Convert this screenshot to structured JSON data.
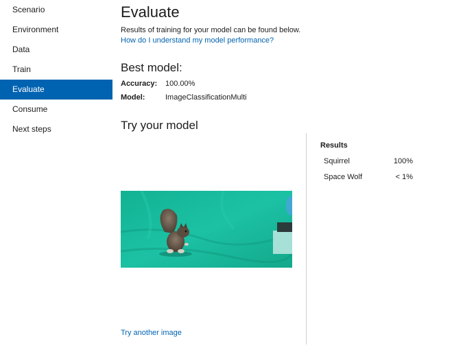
{
  "sidebar": {
    "items": [
      {
        "label": "Scenario"
      },
      {
        "label": "Environment"
      },
      {
        "label": "Data"
      },
      {
        "label": "Train"
      },
      {
        "label": "Evaluate",
        "active": true
      },
      {
        "label": "Consume"
      },
      {
        "label": "Next steps"
      }
    ],
    "active_color": "#0063b1"
  },
  "main": {
    "title": "Evaluate",
    "description": "Results of training for your model can be found below.",
    "help_link": "How do I understand my model performance?",
    "best_model": {
      "heading": "Best model:",
      "accuracy_label": "Accuracy:",
      "accuracy_value": "100.00%",
      "model_label": "Model:",
      "model_value": "ImageClassificationMulti"
    },
    "try_model": {
      "heading": "Try your model",
      "image_icon": "squirrel-toy-photo",
      "try_another_link": "Try another image"
    }
  },
  "results": {
    "title": "Results",
    "rows": [
      {
        "label": "Squirrel",
        "value": "100%"
      },
      {
        "label": "Space Wolf",
        "value": "< 1%"
      }
    ]
  },
  "colors": {
    "link": "#0063b1",
    "image_background": "#17b99b"
  }
}
